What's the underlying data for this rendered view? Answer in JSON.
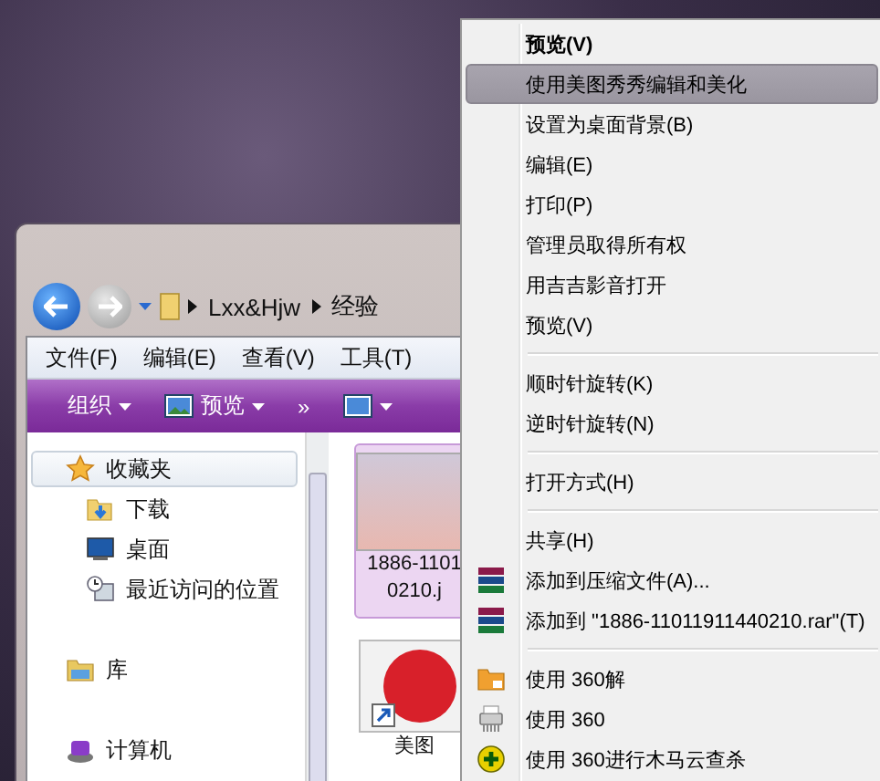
{
  "explorer": {
    "breadcrumb": [
      "Lxx&Hjw",
      "经验"
    ],
    "menu_bar": [
      "文件(F)",
      "编辑(E)",
      "查看(V)",
      "工具(T)"
    ],
    "toolbar": [
      {
        "kind": "menu",
        "label": "组织"
      },
      {
        "kind": "icon_menu",
        "label": "预览"
      },
      {
        "kind": "overflow",
        "label": "»"
      },
      {
        "kind": "icon_only"
      }
    ],
    "nav": [
      {
        "kind": "favorites",
        "label": "收藏夹",
        "selected": true,
        "children": [
          {
            "kind": "downloads",
            "label": "下载",
            "selected": false
          },
          {
            "kind": "desktop",
            "label": "桌面",
            "selected": false
          },
          {
            "kind": "recent",
            "label": "最近访问的位置",
            "selected": false
          }
        ]
      },
      {
        "kind": "library",
        "label": "库",
        "selected": false
      },
      {
        "kind": "computer",
        "label": "计算机",
        "selected": false
      }
    ],
    "files": [
      {
        "kind": "photo",
        "label_lines": [
          "1886-1101",
          "0210.j"
        ],
        "selected": true
      },
      {
        "kind": "app_shortcut",
        "label_lines": [
          "美图"
        ],
        "selected": false
      }
    ]
  },
  "context_menu": [
    {
      "kind": "plain",
      "label": "预览(V)",
      "default": true,
      "selected": false
    },
    {
      "kind": "plain",
      "label": "使用美图秀秀编辑和美化",
      "default": false,
      "selected": true
    },
    {
      "kind": "plain",
      "label": "设置为桌面背景(B)",
      "default": false,
      "selected": false
    },
    {
      "kind": "plain",
      "label": "编辑(E)",
      "default": false,
      "selected": false
    },
    {
      "kind": "plain",
      "label": "打印(P)",
      "default": false,
      "selected": false
    },
    {
      "kind": "plain",
      "label": "管理员取得所有权",
      "default": false,
      "selected": false
    },
    {
      "kind": "plain",
      "label": "用吉吉影音打开",
      "default": false,
      "selected": false
    },
    {
      "kind": "plain",
      "label": "预览(V)",
      "default": false,
      "selected": false
    },
    {
      "kind": "separator"
    },
    {
      "kind": "plain",
      "label": "顺时针旋转(K)",
      "default": false,
      "selected": false
    },
    {
      "kind": "plain",
      "label": "逆时针旋转(N)",
      "default": false,
      "selected": false
    },
    {
      "kind": "separator"
    },
    {
      "kind": "plain",
      "label": "打开方式(H)",
      "default": false,
      "selected": false
    },
    {
      "kind": "separator"
    },
    {
      "kind": "plain",
      "label": "共享(H)",
      "default": false,
      "selected": false
    },
    {
      "kind": "archive",
      "label": "添加到压缩文件(A)...",
      "default": false,
      "selected": false
    },
    {
      "kind": "archive",
      "label": "添加到 \"1886-11011911440210.rar\"(T)",
      "default": false,
      "selected": false
    },
    {
      "kind": "separator"
    },
    {
      "kind": "folder_360",
      "label": "使用 360解",
      "default": false,
      "selected": false
    },
    {
      "kind": "shredder",
      "label": "使用 360",
      "default": false,
      "selected": false
    },
    {
      "kind": "plus_circle",
      "label": "使用 360进行木马云查杀",
      "default": false,
      "selected": false
    }
  ]
}
